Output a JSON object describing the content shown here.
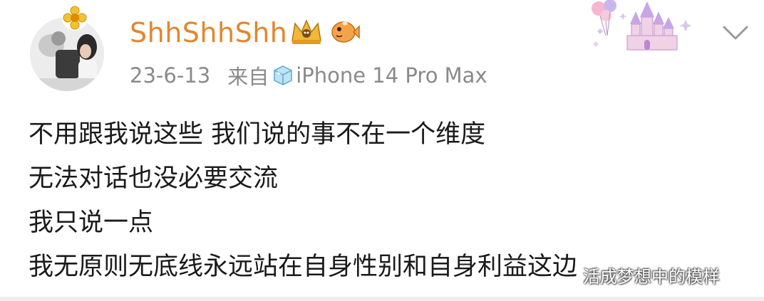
{
  "post": {
    "username": "ShhShhShh",
    "date": "23-6-13",
    "source_prefix": "来自",
    "device": "iPhone 14 Pro Max",
    "lines": [
      "不用跟我说这些 我们说的事不在一个维度",
      "无法对话也没必要交流",
      "我只说一点",
      "我无原则无底线永远站在自身性别和自身利益这边"
    ]
  },
  "watermark": "活成梦想中的模样",
  "icons": {
    "avatar_badge": "flower-badge-icon",
    "crown": "crown-badge-icon",
    "pufferfish": "pufferfish-badge-icon",
    "device": "ice-cube-icon",
    "decoration": "castle-balloon-decoration",
    "more": "chevron-down-icon"
  },
  "colors": {
    "username": "#e3862f",
    "meta": "#8a8a8a",
    "text": "#1a1a1a"
  }
}
